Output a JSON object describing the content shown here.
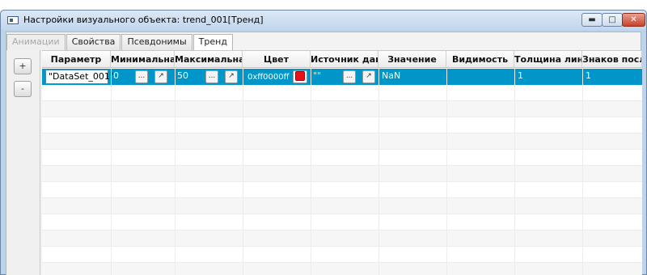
{
  "window": {
    "title": "Настройки визуального объекта: trend_001[Тренд]",
    "minimize_glyph": "▬",
    "maximize_glyph": "□",
    "close_glyph": "✕"
  },
  "tabs": [
    {
      "label": "Анимации",
      "state": "disabled"
    },
    {
      "label": "Свойства",
      "state": "normal"
    },
    {
      "label": "Псевдонимы",
      "state": "normal"
    },
    {
      "label": "Тренд",
      "state": "active"
    }
  ],
  "side_buttons": {
    "add": "+",
    "remove": "-"
  },
  "columns": [
    "Параметр",
    "Минимальна...",
    "Максимальна...",
    "Цвет",
    "Источник дан...",
    "Значение",
    "Видимость",
    "Толщина линии",
    "Знаков после..."
  ],
  "row": {
    "parameter": "\"DataSet_001\"",
    "min": "0",
    "max": "50",
    "color": "0xff0000ff",
    "source": "\"\"",
    "value": "NaN",
    "visibility": "",
    "line_width": "1",
    "decimals": "1",
    "ellipsis": "...",
    "open_glyph": "↗"
  },
  "colors": {
    "selection": "#0096c9",
    "color_swatch": "#e8101a"
  }
}
